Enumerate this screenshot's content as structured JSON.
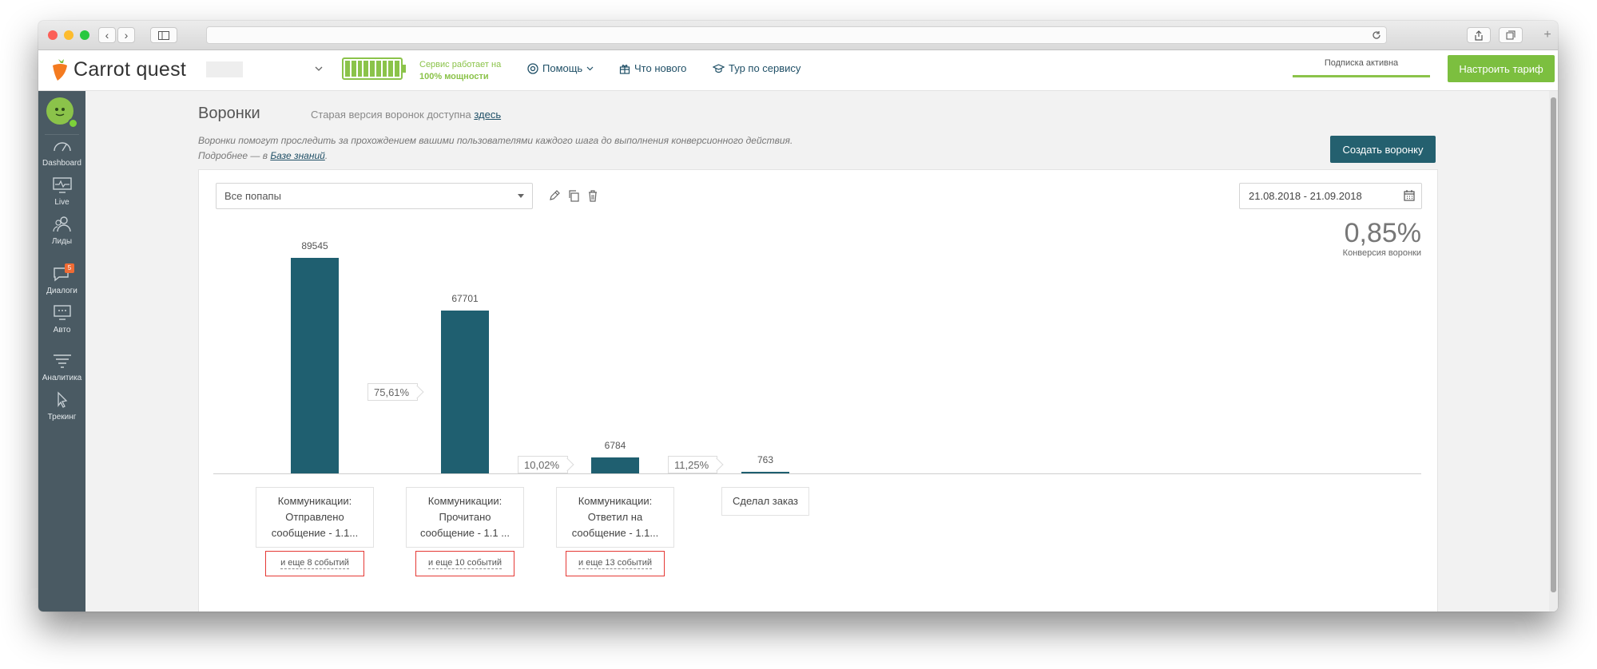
{
  "header": {
    "logo_text": "Carrot quest",
    "service_status": "Сервис работает на",
    "service_power": "100% мощности",
    "nav": [
      {
        "label": "Помощь",
        "icon": "lifebuoy-icon"
      },
      {
        "label": "Что нового",
        "icon": "gift-icon"
      },
      {
        "label": "Тур по сервису",
        "icon": "graduation-cap-icon"
      }
    ],
    "subscription": "Подписка активна",
    "tariff_button": "Настроить тариф"
  },
  "sidebar": {
    "items": [
      {
        "label": "Dashboard",
        "icon": "speedometer-icon"
      },
      {
        "label": "Live",
        "icon": "monitor-pulse-icon"
      },
      {
        "label": "Лиды",
        "icon": "users-icon"
      },
      {
        "label": "Диалоги",
        "icon": "chat-icon",
        "badge": "5"
      },
      {
        "label": "Авто",
        "icon": "auto-message-icon"
      },
      {
        "label": "Аналитика",
        "icon": "filter-icon"
      },
      {
        "label": "Трекинг",
        "icon": "cursor-icon"
      }
    ]
  },
  "page": {
    "title": "Воронки",
    "subtitle": "Старая версия воронок доступна",
    "subtitle_link": "здесь",
    "desc_line1": "Воронки помогут проследить за прохождением вашими пользователями каждого шага до выполнения конверсионного действия.",
    "desc_line2_prefix": "Подробнее — в",
    "desc_link": "Базе знаний",
    "desc_suffix": ".",
    "create_button": "Создать воронку"
  },
  "filters": {
    "popup_select": "Все попапы",
    "date_range": "21.08.2018 - 21.09.2018"
  },
  "conversion": {
    "value": "0,85%",
    "label": "Конверсия воронки"
  },
  "chart_data": {
    "type": "bar",
    "categories": [
      "Коммуникации: Отправлено сообщение - 1.1...",
      "Коммуникации: Прочитано сообщение - 1.1 ...",
      "Коммуникации: Ответил на сообщение - 1.1...",
      "Сделал заказ"
    ],
    "values": [
      89545,
      67701,
      6784,
      763
    ],
    "step_conversions": [
      "75,61%",
      "10,02%",
      "11,25%"
    ],
    "more_events": [
      "и еще 8 событий",
      "и еще 10 событий",
      "и еще 13 событий"
    ],
    "ylim": [
      0,
      89545
    ],
    "grid": false
  },
  "steps": [
    {
      "l1": "Коммуникации:",
      "l2": "Отправлено",
      "l3": "сообщение - 1.1...",
      "more": "и еще 8 событий"
    },
    {
      "l1": "Коммуникации:",
      "l2": "Прочитано",
      "l3": "сообщение - 1.1 ...",
      "more": "и еще 10 событий"
    },
    {
      "l1": "Коммуникации:",
      "l2": "Ответил на",
      "l3": "сообщение - 1.1...",
      "more": "и еще 13 событий"
    },
    {
      "l1": "Сделал заказ"
    }
  ],
  "colors": {
    "bar": "#1f5f70",
    "sidebar": "#4a5a63",
    "accent_green": "#7cbf3f",
    "primary_button": "#24606f",
    "highlight_red": "#e53935"
  }
}
